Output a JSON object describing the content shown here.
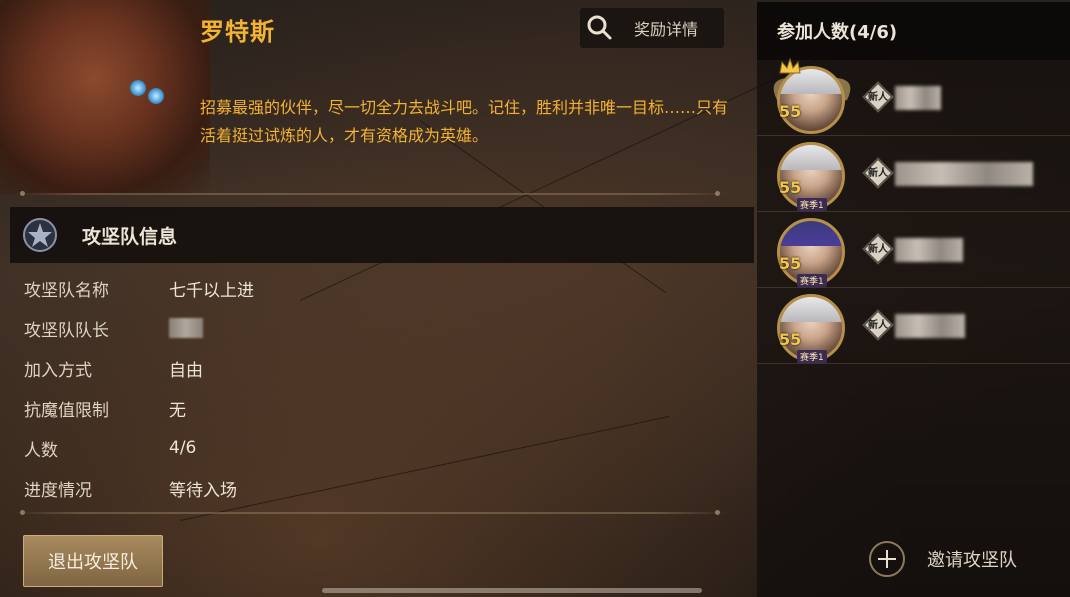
{
  "boss": {
    "name": "罗特斯",
    "description": "招募最强的伙伴，尽一切全力去战斗吧。记住，胜利并非唯一目标……只有活着挺过试炼的人，才有资格成为英雄。",
    "reward_label": "奖励详情"
  },
  "team_info": {
    "section_title": "攻坚队信息",
    "rows": [
      {
        "label": "攻坚队名称",
        "value": "七千以上进"
      },
      {
        "label": "攻坚队队长",
        "value": ""
      },
      {
        "label": "加入方式",
        "value": "自由"
      },
      {
        "label": "抗魔值限制",
        "value": "无"
      },
      {
        "label": "人数",
        "value": "4/6"
      },
      {
        "label": "进度情况",
        "value": "等待入场"
      }
    ],
    "exit_label": "退出攻坚队"
  },
  "participants": {
    "header": "参加人数(4/6)",
    "members": [
      {
        "level": "55",
        "badge": "新人",
        "leader": true,
        "season_tag": ""
      },
      {
        "level": "55",
        "badge": "新人",
        "leader": false,
        "season_tag": "赛季1"
      },
      {
        "level": "55",
        "badge": "新人",
        "leader": false,
        "season_tag": "赛季1"
      },
      {
        "level": "55",
        "badge": "新人",
        "leader": false,
        "season_tag": "赛季1"
      }
    ],
    "invite_label": "邀请攻坚队"
  },
  "colors": {
    "accent_gold": "#f2b233",
    "button_bronze": "#a88a5e"
  }
}
